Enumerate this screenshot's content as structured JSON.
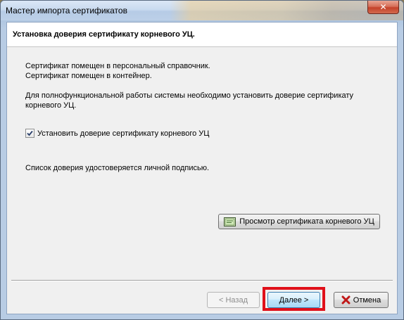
{
  "window": {
    "title": "Мастер импорта сертификатов",
    "close_label": "✕"
  },
  "header": {
    "title": "Установка доверия сертификату корневого УЦ."
  },
  "body": {
    "line1": "Сертификат помещен в персональный справочник.",
    "line2": "Сертификат помещен в контейнер.",
    "para_line1": "Для полнофункциональной работы системы необходимо установить доверие сертификату",
    "para_line2": "корневого УЦ.",
    "checkbox_label": "Установить доверие сертификату корневого УЦ",
    "checkbox_checked": true,
    "note": "Список доверия удостоверяется личной подписью."
  },
  "buttons": {
    "view_cert": "Просмотр сертификата корневого УЦ",
    "back": "< Назад",
    "next": "Далее >",
    "cancel": "Отмена"
  },
  "icons": {
    "view_cert": "certificate-icon",
    "cancel": "cancel-x-icon",
    "close": "close-icon"
  },
  "colors": {
    "highlight": "#e0101a",
    "cancel_icon": "#c01818"
  }
}
